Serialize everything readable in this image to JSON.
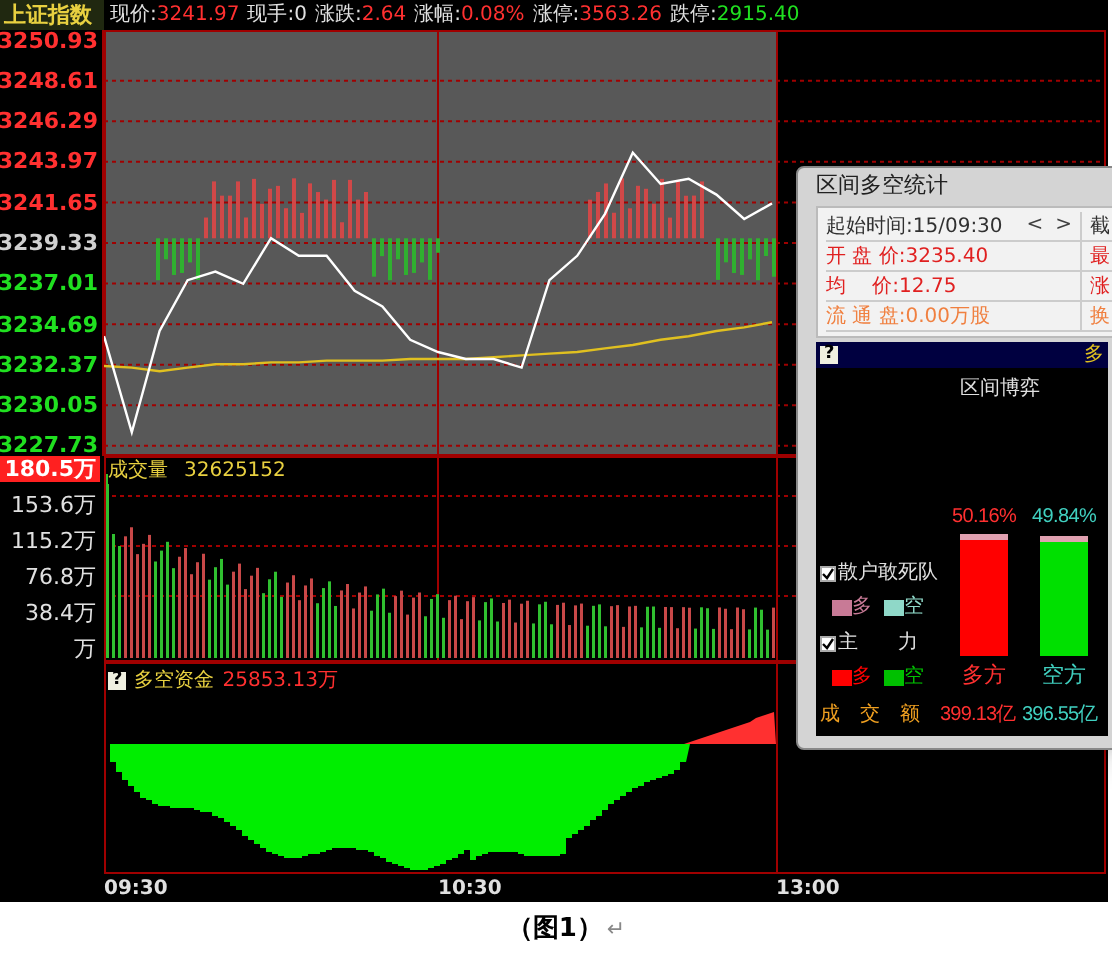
{
  "quote_bar": {
    "index_name": "上证指数",
    "fields": [
      {
        "label": "现价:",
        "value": "3241.97",
        "color": "#ff3030"
      },
      {
        "label": "现手:",
        "value": "0",
        "color": "#e0e0e0"
      },
      {
        "label": "涨跌:",
        "value": "2.64",
        "color": "#ff3030"
      },
      {
        "label": "涨幅:",
        "value": "0.08%",
        "color": "#ff3030"
      },
      {
        "label": "涨停:",
        "value": "3563.26",
        "color": "#ff3030"
      },
      {
        "label": "跌停:",
        "value": "2915.40",
        "color": "#20e020"
      }
    ]
  },
  "price_chart": {
    "chart_data": {
      "type": "line",
      "categories": [
        null,
        null,
        null,
        null,
        null,
        null,
        null,
        null,
        null,
        null,
        null,
        null,
        null,
        null,
        null,
        null,
        null,
        null,
        null,
        null,
        null,
        null,
        null,
        null,
        null
      ],
      "series": [
        {
          "color": "#ffffff",
          "values": [
            3234,
            3228.5,
            3234.3,
            3237.2,
            3237.7,
            3237,
            3239.6,
            3238.6,
            3238.6,
            3236.6,
            3235.7,
            3233.8,
            3233.1,
            3232.7,
            3232.7,
            3232.2,
            3237.2,
            3238.6,
            3241,
            3244.5,
            3242.7,
            3243,
            3242.1,
            3240.7,
            3241.6
          ]
        },
        {
          "color": "#e0c020",
          "values": [
            3232.3,
            3232.2,
            3232,
            3232.2,
            3232.4,
            3232.4,
            3232.5,
            3232.5,
            3232.6,
            3232.6,
            3232.6,
            3232.7,
            3232.7,
            3232.7,
            3232.8,
            3232.9,
            3233,
            3233.1,
            3233.3,
            3233.5,
            3233.8,
            3234,
            3234.3,
            3234.5,
            3234.8
          ]
        }
      ],
      "ylim": [
        3227.15,
        3251.51
      ],
      "grid": true,
      "yticks": [
        3227.73,
        3230.05,
        3232.37,
        3234.69,
        3237.01,
        3239.33,
        3241.65,
        3243.97,
        3246.29,
        3248.61,
        3250.93
      ]
    }
  },
  "volume_panel": {
    "title": "成交量",
    "value": "32625152",
    "axis": [
      {
        "label": "180.5万",
        "selected": true
      },
      {
        "label": "153.6万",
        "selected": false
      },
      {
        "label": "115.2万",
        "selected": false
      },
      {
        "label": "76.8万",
        "selected": false
      },
      {
        "label": "38.4万",
        "selected": false
      },
      {
        "label": "万",
        "selected": false
      }
    ]
  },
  "flow_panel": {
    "help": "?",
    "title": "多空资金",
    "value": "25853.13万"
  },
  "time_axis": [
    "09:30",
    "10:30",
    "13:00"
  ],
  "popup": {
    "title": "区间多空统计",
    "nav": [
      "<",
      ">"
    ],
    "info_rows": [
      {
        "left": "起始时间:15/09:30",
        "right": "截",
        "kind": "time"
      },
      {
        "left": "开 盘 价:3235.40",
        "right": "最",
        "kind": "red"
      },
      {
        "left": "均　 价:12.75",
        "right": "涨",
        "kind": "red"
      },
      {
        "left": "流 通 盘:0.00万股",
        "right": "换",
        "kind": "orange"
      }
    ],
    "help": "?",
    "header": "多",
    "chart_title": "区间博弈",
    "legend": [
      {
        "label": "散户敢死队",
        "checked": true,
        "swatches": [
          {
            "label": "多",
            "color": "#c87a96"
          },
          {
            "label": "空",
            "color": "#8fd8c8"
          }
        ]
      },
      {
        "label": "主　　力",
        "checked": true,
        "swatches": [
          {
            "label": "多",
            "color": "#ff0000"
          },
          {
            "label": "空",
            "color": "#00c000"
          }
        ]
      }
    ],
    "turnover_label": "成　交　额",
    "bars": [
      {
        "kind": "long",
        "percent": "50.16%",
        "label": "多方",
        "amount": "399.13亿",
        "level": 0.5016,
        "color": "#ff0000"
      },
      {
        "kind": "short",
        "percent": "49.84%",
        "label": "空方",
        "amount": "396.55亿",
        "level": 0.4984,
        "color": "#00e000"
      }
    ]
  },
  "caption": "（图1）",
  "paragraph_mark": "↵"
}
